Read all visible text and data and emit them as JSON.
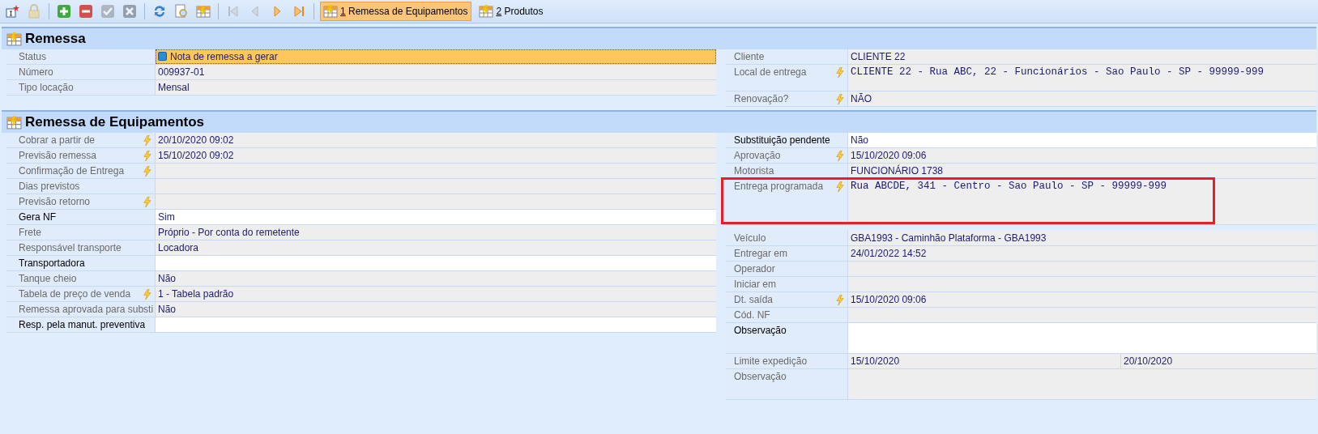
{
  "toolbar": {
    "buttons": [
      {
        "kind": "new",
        "disabled": false
      },
      {
        "kind": "lock",
        "disabled": true
      },
      {
        "kind": "add",
        "disabled": false
      },
      {
        "kind": "remove",
        "disabled": false
      },
      {
        "kind": "confirm",
        "disabled": true
      },
      {
        "kind": "cancel",
        "disabled": true
      },
      {
        "kind": "refresh",
        "disabled": false
      },
      {
        "kind": "preview",
        "disabled": false
      },
      {
        "kind": "grid",
        "disabled": false
      },
      {
        "kind": "first",
        "disabled": true
      },
      {
        "kind": "prev",
        "disabled": true
      },
      {
        "kind": "next",
        "disabled": false
      },
      {
        "kind": "last",
        "disabled": false
      }
    ],
    "tabs": [
      {
        "key": "1",
        "label": "Remessa de Equipamentos",
        "selected": true
      },
      {
        "key": "2",
        "label": "Produtos",
        "selected": false
      }
    ]
  },
  "sections": [
    {
      "title": "Remessa",
      "left": [
        {
          "label": "Status",
          "value": "Nota de remessa a gerar",
          "kind": "status",
          "flash": false,
          "editable": false,
          "highlighted": false
        },
        {
          "label": "Número",
          "value": "009937-01",
          "kind": "text",
          "flash": false,
          "editable": false,
          "highlighted": false
        },
        {
          "label": "Tipo locação",
          "value": "Mensal",
          "kind": "text",
          "flash": false,
          "editable": false,
          "highlighted": false
        }
      ],
      "right": [
        {
          "label": "Cliente",
          "value": "CLIENTE 22",
          "kind": "text",
          "flash": false,
          "editable": false,
          "highlighted": false
        },
        {
          "label": "Local de entrega",
          "value": "CLIENTE 22 - Rua ABC, 22 - Funcionários - Sao Paulo - SP - 99999-999",
          "kind": "address",
          "flash": true,
          "editable": false,
          "highlighted": false
        },
        {
          "label": "Renovação?",
          "value": "NÃO",
          "kind": "text",
          "flash": true,
          "editable": false,
          "highlighted": false
        }
      ]
    },
    {
      "title": "Remessa de Equipamentos",
      "left": [
        {
          "label": "Cobrar a partir de",
          "value": "20/10/2020 09:02",
          "kind": "text",
          "flash": true,
          "editable": false,
          "highlighted": false
        },
        {
          "label": "Previsão remessa",
          "value": "15/10/2020 09:02",
          "kind": "text",
          "flash": true,
          "editable": false,
          "highlighted": false
        },
        {
          "label": "Confirmação de Entrega",
          "kind": "text",
          "flash": true,
          "editable": false,
          "highlighted": false
        },
        {
          "label": "Dias previstos",
          "kind": "text",
          "flash": false,
          "editable": false,
          "highlighted": false
        },
        {
          "label": "Previsão retorno",
          "kind": "text",
          "flash": true,
          "editable": false,
          "highlighted": false
        },
        {
          "label": "Gera NF",
          "value": "Sim",
          "kind": "text",
          "flash": false,
          "editable": true,
          "highlighted": false
        },
        {
          "label": "Frete",
          "value": "Próprio - Por conta do remetente",
          "kind": "text",
          "flash": false,
          "editable": false,
          "highlighted": false
        },
        {
          "label": "Responsável transporte",
          "value": "Locadora",
          "kind": "text",
          "flash": false,
          "editable": false,
          "highlighted": false
        },
        {
          "label": "Transportadora",
          "kind": "text",
          "flash": false,
          "editable": true,
          "highlighted": false
        },
        {
          "label": "Tanque cheio",
          "value": "Não",
          "kind": "text",
          "flash": false,
          "editable": false,
          "highlighted": false
        },
        {
          "label": "Tabela de preço de venda",
          "value": "1 - Tabela padrão",
          "kind": "text",
          "flash": true,
          "editable": false,
          "highlighted": false
        },
        {
          "label": "Remessa aprovada para substi",
          "value": "Não",
          "kind": "text",
          "flash": false,
          "editable": false,
          "highlighted": false
        },
        {
          "label": "Resp. pela manut. preventiva",
          "kind": "text",
          "flash": false,
          "editable": true,
          "highlighted": false
        }
      ],
      "right": [
        {
          "label": "Substituição pendente",
          "value": "Não",
          "kind": "text",
          "flash": false,
          "editable": true,
          "highlighted": false
        },
        {
          "label": "Aprovação",
          "value": "15/10/2020 09:06",
          "kind": "text",
          "flash": true,
          "editable": false,
          "highlighted": false
        },
        {
          "label": "Motorista",
          "value": "FUNCIONÁRIO  1738",
          "kind": "text",
          "flash": false,
          "editable": false,
          "highlighted": false
        },
        {
          "label": "Entrega programada",
          "value": "Rua ABCDE, 341 - Centro - Sao Paulo - SP - 99999-999",
          "kind": "address",
          "flash": true,
          "editable": false,
          "highlighted": true
        },
        {
          "label": "Veículo",
          "value": "GBA1993 - Caminhão Plataforma - GBA1993",
          "kind": "text",
          "flash": false,
          "editable": false,
          "highlighted": false
        },
        {
          "label": "Entregar em",
          "value": "24/01/2022 14:52",
          "kind": "text",
          "flash": false,
          "editable": false,
          "highlighted": false
        },
        {
          "label": "Operador",
          "kind": "text",
          "flash": false,
          "editable": false,
          "highlighted": false
        },
        {
          "label": "Iniciar em",
          "kind": "text",
          "flash": false,
          "editable": false,
          "highlighted": false
        },
        {
          "label": "Dt. saída",
          "value": "15/10/2020 09:06",
          "kind": "text",
          "flash": true,
          "editable": false,
          "highlighted": false
        },
        {
          "label": "Cód. NF",
          "kind": "text",
          "flash": false,
          "editable": false,
          "highlighted": false
        },
        {
          "label": "Observação",
          "kind": "memo",
          "flash": false,
          "editable": true,
          "highlighted": false
        },
        {
          "label": "Limite expedição",
          "values": [
            "15/10/2020",
            "20/10/2020"
          ],
          "kind": "range",
          "flash": false,
          "editable": false,
          "highlighted": false
        },
        {
          "label": "Observação",
          "kind": "memo",
          "flash": false,
          "editable": false,
          "highlighted": false
        }
      ]
    }
  ]
}
